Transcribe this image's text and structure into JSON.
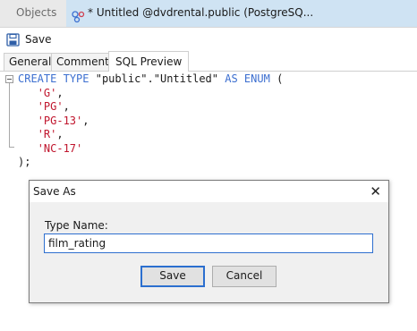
{
  "tabs": {
    "objects_label": "Objects",
    "active_label": "* Untitled @dvdrental.public (PostgreSQ..."
  },
  "toolbar": {
    "save_label": "Save"
  },
  "subtabs": {
    "general": "General",
    "comment": "Comment",
    "sql_preview": "SQL Preview"
  },
  "sql": {
    "line1_kw1": "CREATE",
    "line1_kw2": "TYPE",
    "line1_id": "\"public\".\"Untitled\"",
    "line1_kw3": "AS ENUM",
    "line1_paren": "(",
    "values": [
      "'G'",
      "'PG'",
      "'PG-13'",
      "'R'",
      "'NC-17'"
    ],
    "close": ");"
  },
  "dialog": {
    "title": "Save As",
    "field_label": "Type Name:",
    "field_value": "film_rating",
    "save_button": "Save",
    "cancel_button": "Cancel"
  },
  "colors": {
    "keyword": "#3c6fd0",
    "string": "#c0152d",
    "active_tab": "#cfe3f3"
  }
}
